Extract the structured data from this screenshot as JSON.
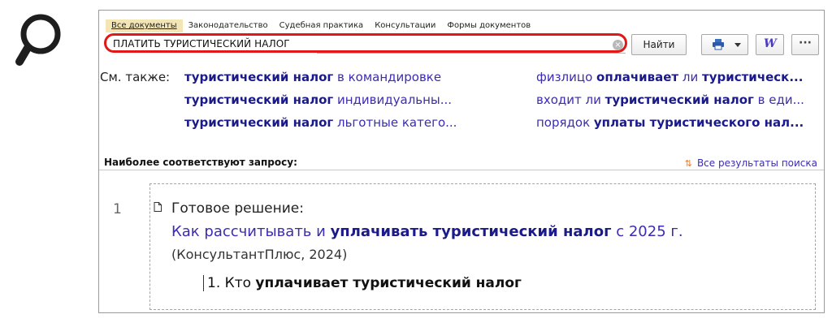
{
  "tabs": [
    "Все документы",
    "Законодательство",
    "Судебная практика",
    "Консультации",
    "Формы документов"
  ],
  "search": {
    "value": "ПЛАТИТЬ ТУРИСТИЧЕСКИЙ НАЛОГ"
  },
  "find_label": "Найти",
  "icons": {
    "magnifier": "magnifier-icon",
    "print": "printer-icon",
    "word": "word-export-icon",
    "more": "ellipsis-icon",
    "clear": "clear-icon"
  },
  "colors": {
    "highlight": "#e01818",
    "link": "#3b2bb5",
    "tab_active": "#f4e6b4"
  },
  "see_also": {
    "label": "См. также:",
    "left": [
      {
        "bold": "туристический налог",
        "rest": " в командировке"
      },
      {
        "bold": "туристический налог",
        "rest": " индивидуальны..."
      },
      {
        "bold": "туристический налог",
        "rest": " льготные катего..."
      }
    ],
    "right": [
      {
        "pre": "физлицо ",
        "bold": "оплачивает",
        "mid": " ли ",
        "bold2": "туристическ..."
      },
      {
        "pre": "входит ли ",
        "bold": "туристический налог",
        "mid": " в еди...",
        "bold2": ""
      },
      {
        "pre": "порядок ",
        "bold": "уплаты туристического нал...",
        "mid": "",
        "bold2": ""
      }
    ]
  },
  "results": {
    "header": "Наиболее соответствуют запросу:",
    "all_link": "Все результаты поиска",
    "item": {
      "number": "1",
      "label": "Готовое решение:",
      "title_pre": "Как рассчитывать и ",
      "title_bold": "уплачивать туристический налог",
      "title_post": " с 2025 г.",
      "source": "(КонсультантПлюс, 2024)",
      "section_pre": "1. Кто ",
      "section_bold": "уплачивает туристический налог"
    }
  }
}
